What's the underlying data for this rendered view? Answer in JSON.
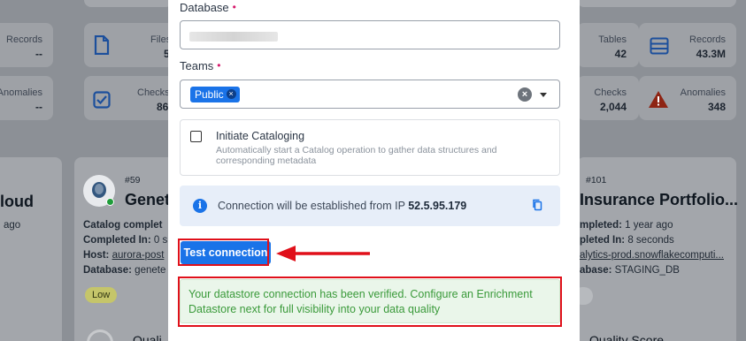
{
  "background": {
    "stats": [
      {
        "label": "Records",
        "value": "--"
      },
      {
        "label": "Files",
        "value": "5"
      },
      {
        "label": "Anomalies",
        "value": "--"
      },
      {
        "label": "Checks",
        "value": "86"
      },
      {
        "label": "Tables",
        "value": "42"
      },
      {
        "label": "Records",
        "value": "43.3M"
      },
      {
        "label": "Checks",
        "value": "2,044"
      },
      {
        "label": "Anomalies",
        "value": "348"
      }
    ],
    "left_card": {
      "title": "loud",
      "subtitle": "ago"
    },
    "middle_card": {
      "id": "#59",
      "title": "Genet",
      "line1_label": "Catalog complet",
      "line2_label": "Completed In:",
      "line2_value": "0 s",
      "line3_label": "Host:",
      "line3_value": "aurora-post",
      "line4_label": "Database:",
      "line4_value": "genete",
      "badge": "Low",
      "footer": "Quali"
    },
    "right_card": {
      "id": "#101",
      "title": "Insurance Portfolio...",
      "line1_label": "mpleted:",
      "line1_value": "1 year ago",
      "line2_label": "pleted In:",
      "line2_value": "8 seconds",
      "line3_value": "alytics-prod.snowflakecomputi...",
      "line4_label": "abase:",
      "line4_value": "STAGING_DB",
      "footer": "Quality Score"
    }
  },
  "modal": {
    "database_label": "Database",
    "teams_label": "Teams",
    "required_mark": "•",
    "team_chip": "Public",
    "chip_remove": "×",
    "clear_icon": "×",
    "catalog_title": "Initiate Cataloging",
    "catalog_desc": "Automatically start a Catalog operation to gather data structures and corresponding metadata",
    "info_text": "Connection will be established from IP",
    "info_ip": "52.5.95.179",
    "test_button": "Test connection",
    "success_message": "Your datastore connection has been verified. Configure an Enrichment Datastore next for full visibility into your data quality"
  },
  "colors": {
    "accent": "#1a73e8",
    "required": "#d6196b",
    "annotation": "#e0101a",
    "success_text": "#3a9a3a",
    "info_bg": "#e7eef9"
  }
}
